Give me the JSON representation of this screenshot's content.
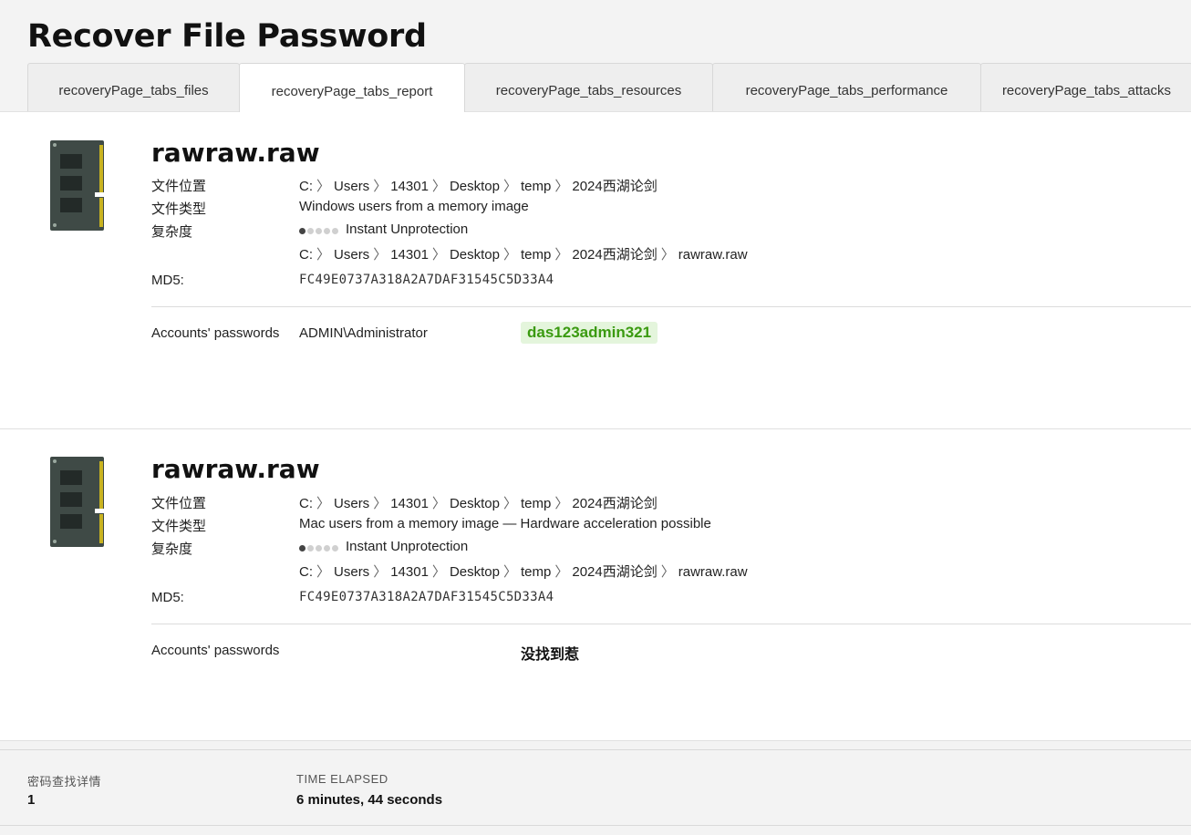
{
  "page_title": "Recover File Password",
  "tabs": [
    {
      "label": "recoveryPage_tabs_files",
      "active": false
    },
    {
      "label": "recoveryPage_tabs_report",
      "active": true
    },
    {
      "label": "recoveryPage_tabs_resources",
      "active": false
    },
    {
      "label": "recoveryPage_tabs_performance",
      "active": false
    },
    {
      "label": "recoveryPage_tabs_attacks",
      "active": false
    }
  ],
  "files": [
    {
      "name": "rawraw.raw",
      "icon": "memory-module-icon",
      "location_label": "文件位置",
      "location_crumbs": [
        "C:",
        "Users",
        "14301",
        "Desktop",
        "temp",
        "2024西湖论剑"
      ],
      "type_label": "文件类型",
      "type_value": "Windows users from a memory image",
      "complexity_label": "复杂度",
      "complexity_level": 1,
      "complexity_max": 5,
      "complexity_text": "Instant Unprotection",
      "path_crumbs": [
        "C:",
        "Users",
        "14301",
        "Desktop",
        "temp",
        "2024西湖论剑",
        "rawraw.raw"
      ],
      "md5_label": "MD5:",
      "md5_value": "FC49E0737A318A2A7DAF31545C5D33A4",
      "accounts_label": "Accounts' passwords",
      "account_name": "ADMIN\\Administrator",
      "password": "das123admin321",
      "not_found": ""
    },
    {
      "name": "rawraw.raw",
      "icon": "memory-module-icon",
      "location_label": "文件位置",
      "location_crumbs": [
        "C:",
        "Users",
        "14301",
        "Desktop",
        "temp",
        "2024西湖论剑"
      ],
      "type_label": "文件类型",
      "type_value": "Mac users from a memory image — Hardware acceleration possible",
      "complexity_label": "复杂度",
      "complexity_level": 1,
      "complexity_max": 5,
      "complexity_text": "Instant Unprotection",
      "path_crumbs": [
        "C:",
        "Users",
        "14301",
        "Desktop",
        "temp",
        "2024西湖论剑",
        "rawraw.raw"
      ],
      "md5_label": "MD5:",
      "md5_value": "FC49E0737A318A2A7DAF31545C5D33A4",
      "accounts_label": "Accounts' passwords",
      "account_name": "",
      "password": "",
      "not_found": "没找到惹"
    }
  ],
  "footer": {
    "found_label": "密码查找详情",
    "found_value": "1",
    "time_label": "TIME ELAPSED",
    "time_value": "6 minutes, 44 seconds"
  },
  "colors": {
    "password_text": "#3a9a10",
    "password_bg": "#e4f5dc",
    "icon_body": "#3f4a46"
  }
}
